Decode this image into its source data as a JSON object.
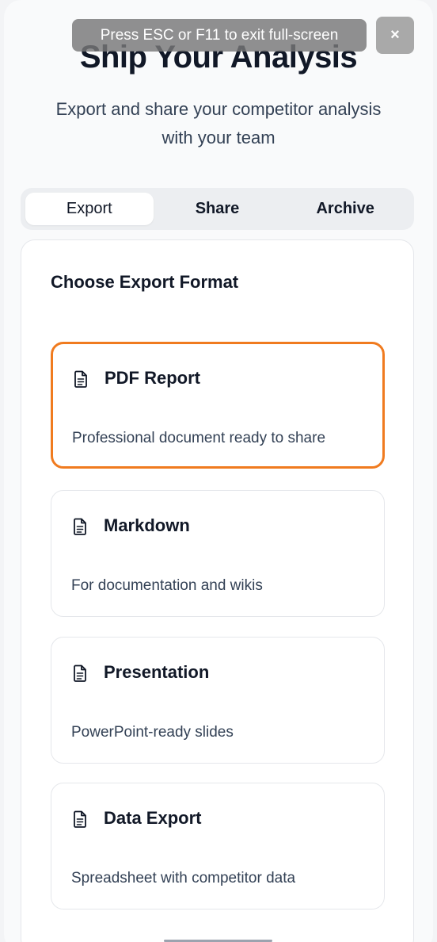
{
  "header": {
    "title": "Ship Your Analysis",
    "subtitle": "Export and share your competitor analysis with your team"
  },
  "fullscreen_notice": {
    "message": "Press ESC or F11 to exit full-screen",
    "close_label": "×"
  },
  "tabs": [
    {
      "label": "Export",
      "active": true
    },
    {
      "label": "Share",
      "active": false
    },
    {
      "label": "Archive",
      "active": false
    }
  ],
  "export": {
    "heading": "Choose Export Format",
    "options": [
      {
        "title": "PDF Report",
        "description": "Professional document ready to share",
        "icon": "document-icon",
        "selected": true
      },
      {
        "title": "Markdown",
        "description": "For documentation and wikis",
        "icon": "document-icon",
        "selected": false
      },
      {
        "title": "Presentation",
        "description": "PowerPoint-ready slides",
        "icon": "document-icon",
        "selected": false
      },
      {
        "title": "Data Export",
        "description": "Spreadsheet with competitor data",
        "icon": "document-icon",
        "selected": false
      }
    ]
  },
  "colors": {
    "accent": "#f07b1f",
    "text": "#111827",
    "muted_text": "#334155"
  }
}
